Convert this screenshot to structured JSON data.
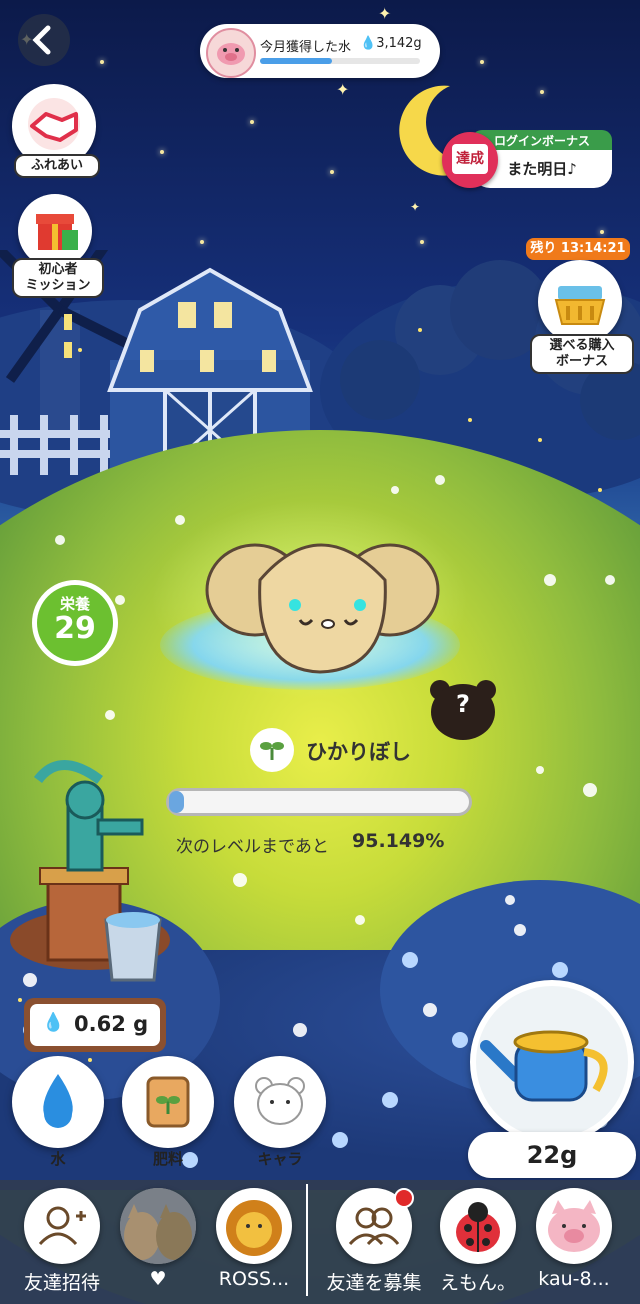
{
  "header": {
    "monthly_water_label": "今月獲得した水",
    "monthly_water_value": "3,142g"
  },
  "login_bonus": {
    "title": "ログインボーナス",
    "badge": "達成",
    "message": "また明日♪"
  },
  "left_menu": [
    {
      "label": "ふれあい"
    },
    {
      "label_line1": "初心者",
      "label_line2": "ミッション"
    }
  ],
  "purchase_bonus": {
    "timer": "残り 13:14:21",
    "label_line1": "選べる購入",
    "label_line2": "ボーナス"
  },
  "nutrition": {
    "label": "栄養",
    "value": "29"
  },
  "character": {
    "name": "ひかりぼし",
    "progress_fraction": 0.049,
    "next_level_label": "次のレベルまであと",
    "next_level_value": "95.149%"
  },
  "mystery_badge": "?",
  "water_stock": "0.62 g",
  "actions": [
    {
      "label": "水",
      "icon": "water-drop-icon"
    },
    {
      "label": "肥料",
      "icon": "fertilizer-icon"
    },
    {
      "label": "キャラ",
      "icon": "character-bear-icon"
    }
  ],
  "watering": {
    "amount": "22g",
    "icon": "watering-can-icon"
  },
  "friends": [
    {
      "name": "友達招待",
      "icon": "add-friend-icon"
    },
    {
      "name": "♥",
      "icon": "cats-avatar"
    },
    {
      "name": "ROSS...",
      "icon": "lion-avatar"
    },
    {
      "name": "友達を募集",
      "icon": "friends-recruit-icon"
    },
    {
      "name": "えもん。",
      "icon": "ladybug-avatar"
    },
    {
      "name": "kau-8...",
      "icon": "pig-avatar"
    }
  ],
  "colors": {
    "accent_green": "#7cc83c",
    "progress_blue": "#6aa6e0",
    "badge_red": "#e0305a",
    "timer_orange": "#f07a1a"
  }
}
